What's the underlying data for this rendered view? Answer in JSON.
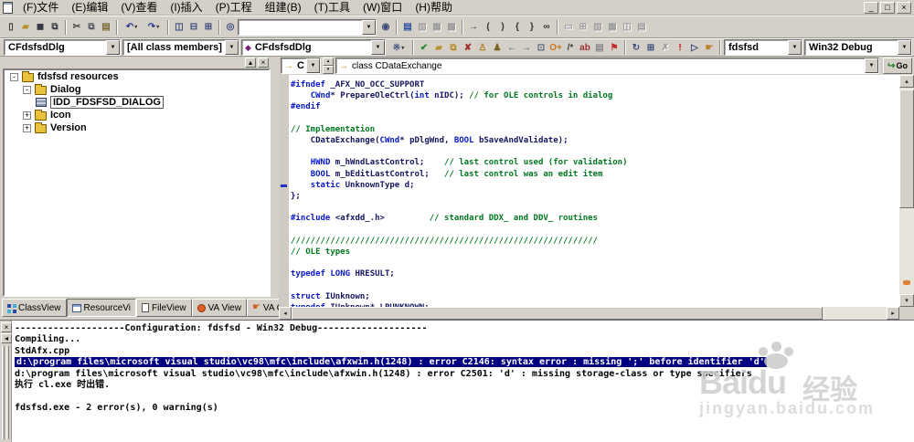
{
  "menu": {
    "items": [
      "(F)文件",
      "(E)编辑",
      "(V)查看",
      "(I)插入",
      "(P)工程",
      "组建(B)",
      "(T)工具",
      "(W)窗口",
      "(H)帮助"
    ]
  },
  "window_buttons": [
    {
      "name": "minimize-button",
      "glyph": "_"
    },
    {
      "name": "restore-button",
      "glyph": "□"
    },
    {
      "name": "close-button",
      "glyph": "×"
    }
  ],
  "toolbar1": {
    "cells": [
      {
        "i": "new-file-icon",
        "g": "▯",
        "c": "#35352a"
      },
      {
        "i": "open-folder-icon",
        "g": "▰",
        "c": "#b8912a"
      },
      {
        "i": "save-icon",
        "g": "◼",
        "c": "#3a3a46"
      },
      {
        "i": "save-all-icon",
        "g": "⧉",
        "c": "#3a3a46"
      },
      {
        "sep": true
      },
      {
        "i": "cut-icon",
        "g": "✂",
        "c": "#444444"
      },
      {
        "i": "copy-icon",
        "g": "⧉",
        "c": "#555566"
      },
      {
        "i": "paste-icon",
        "g": "▤",
        "c": "#7a6a3a"
      },
      {
        "sep": true
      },
      {
        "i": "undo-icon",
        "g": "↶",
        "c": "#2a3a9a",
        "caret": true
      },
      {
        "i": "redo-icon",
        "g": "↷",
        "c": "#2a3a9a",
        "caret": true
      },
      {
        "sep": true
      },
      {
        "i": "workspace-pane-icon",
        "g": "◫",
        "c": "#3a4a7a"
      },
      {
        "i": "output-pane-icon",
        "g": "⊟",
        "c": "#3a4a7a"
      },
      {
        "i": "window-list-icon",
        "g": "⊞",
        "c": "#3a4a7a"
      },
      {
        "sep": true
      },
      {
        "i": "find-in-files-icon",
        "g": "◎",
        "c": "#3a4a7a"
      },
      {
        "combo": "",
        "name": "find-combo",
        "w": 152
      },
      {
        "i": "search-icon",
        "g": "◉",
        "c": "#3a4a7a"
      },
      {
        "sep": true
      },
      {
        "i": "open-header-icon",
        "g": "▤",
        "c": "#2a50a0"
      },
      {
        "i": "edit-code-icon",
        "g": "▥",
        "c": "#999999",
        "d": true
      },
      {
        "i": "list-members-icon",
        "g": "▦",
        "c": "#999999",
        "d": true
      },
      {
        "i": "param-info-icon",
        "g": "▩",
        "c": "#999999",
        "d": true
      },
      {
        "sep": true
      },
      {
        "i": "goto-definition-icon",
        "g": "→",
        "c": "#333333"
      },
      {
        "i": "paren-match-open-icon",
        "g": "(",
        "c": "#333333"
      },
      {
        "i": "paren-match-close-icon",
        "g": ")",
        "c": "#333333"
      },
      {
        "i": "brace-match-open-icon",
        "g": "{",
        "c": "#333333"
      },
      {
        "i": "brace-match-close-icon",
        "g": "}",
        "c": "#333333"
      },
      {
        "i": "reading-glasses-icon",
        "g": "∞",
        "c": "#333333"
      },
      {
        "sep": true
      },
      {
        "i": "test-dialog-icon",
        "g": "▭",
        "c": "#999999",
        "d": true
      },
      {
        "i": "layout-grid-icon",
        "g": "⊞",
        "c": "#999999",
        "d": true
      },
      {
        "i": "align-left-icon",
        "g": "▥",
        "c": "#999999",
        "d": true
      },
      {
        "i": "align-top-icon",
        "g": "▦",
        "c": "#999999",
        "d": true
      },
      {
        "i": "center-horz-icon",
        "g": "◫",
        "c": "#999999",
        "d": true
      },
      {
        "i": "center-vert-icon",
        "g": "▤",
        "c": "#999999",
        "d": true
      }
    ]
  },
  "toolbar2": {
    "cells": [
      {
        "combo": "CFdsfsdDlg",
        "name": "class-combo",
        "w": 128
      },
      {
        "combo": "[All class members]",
        "name": "members-combo",
        "w": 128
      },
      {
        "combo": "CFdsfsdDlg",
        "name": "function-combo",
        "w": 158,
        "diamond": true
      },
      {
        "i": "wizard-actions-icon",
        "g": "※",
        "c": "#405080",
        "caret": true
      },
      {
        "sep": true
      },
      {
        "i": "va-check-file-icon",
        "g": "✔",
        "c": "#2a8a2a"
      },
      {
        "i": "va-open-file-icon",
        "g": "▰",
        "c": "#b8912a"
      },
      {
        "i": "va-rename-icon",
        "g": "⧉",
        "c": "#b8912a"
      },
      {
        "i": "va-find-symbol-icon",
        "g": "✘",
        "c": "#a03030"
      },
      {
        "i": "va-key-gold-icon",
        "g": "♙",
        "c": "#b08020"
      },
      {
        "i": "va-key-brown-icon",
        "g": "♟",
        "c": "#806020"
      },
      {
        "i": "va-back-icon",
        "g": "←",
        "c": "#555555"
      },
      {
        "i": "va-forward-icon",
        "g": "→",
        "c": "#555555"
      },
      {
        "i": "va-paste-icon",
        "g": "⊡",
        "c": "#55617a"
      },
      {
        "i": "va-insert-o-icon",
        "g": "O+",
        "c": "#c87820"
      },
      {
        "i": "va-comment-icon",
        "g": "/*",
        "c": "#444444"
      },
      {
        "i": "va-spell-icon",
        "g": "ab",
        "c": "#a03030"
      },
      {
        "i": "va-note-icon",
        "g": "▤",
        "c": "#888888"
      },
      {
        "i": "va-flag-icon",
        "g": "⚑",
        "c": "#c03030"
      },
      {
        "sep": true
      },
      {
        "i": "compile-icon",
        "g": "↻",
        "c": "#3a4a7a"
      },
      {
        "i": "build-icon",
        "g": "⊞",
        "c": "#3a4a7a"
      },
      {
        "i": "stop-build-icon",
        "g": "✗",
        "c": "#999999",
        "d": true
      },
      {
        "i": "execute-icon",
        "g": "!",
        "c": "#cc1010"
      },
      {
        "i": "debug-go-icon",
        "g": "▷",
        "c": "#3a4a7a"
      },
      {
        "i": "breakpoint-hand-icon",
        "g": "☛",
        "c": "#c08030"
      },
      {
        "sep": true
      },
      {
        "combo": "fdsfsd",
        "name": "project-combo",
        "w": 86
      },
      {
        "combo": "Win32 Debug",
        "name": "config-combo",
        "grow": true
      }
    ]
  },
  "workspace": {
    "pane_buttons": [
      {
        "name": "pane-minimize-button",
        "glyph": "▴"
      },
      {
        "name": "pane-close-button",
        "glyph": "×"
      }
    ],
    "tree": [
      {
        "label": "fdsfsd resources",
        "level": 0,
        "toggle": "-",
        "icon": "folder",
        "selected": false
      },
      {
        "label": "Dialog",
        "level": 1,
        "toggle": "-",
        "icon": "folder",
        "selected": false
      },
      {
        "label": "IDD_FDSFSD_DIALOG",
        "level": 2,
        "toggle": "",
        "icon": "resource",
        "selected": true
      },
      {
        "label": "Icon",
        "level": 1,
        "toggle": "+",
        "icon": "folder",
        "selected": false
      },
      {
        "label": "Version",
        "level": 1,
        "toggle": "+",
        "icon": "folder",
        "selected": false
      }
    ],
    "tabs": [
      {
        "label": "ClassView",
        "icon": "classview-icon",
        "active": false
      },
      {
        "label": "ResourceVi",
        "icon": "resourceview-icon",
        "active": true
      },
      {
        "label": "FileView",
        "icon": "fileview-icon",
        "active": false
      },
      {
        "label": "VA View",
        "icon": "vaview-icon",
        "active": false
      },
      {
        "label": "VA Outlin",
        "icon": "vaoutline-icon",
        "active": false
      }
    ]
  },
  "editor": {
    "nav_context": "C",
    "nav_symbol": "class CDataExchange",
    "go_label": "Go",
    "code_lines": [
      {
        "segs": [
          [
            "k",
            "#ifndef"
          ],
          [
            "i",
            " _AFX_NO_OCC_SUPPORT"
          ]
        ]
      },
      {
        "segs": [
          [
            "i",
            "    "
          ],
          [
            "k",
            "CWnd"
          ],
          [
            "i",
            "* PrepareOleCtrl("
          ],
          [
            "k",
            "int"
          ],
          [
            "i",
            " nIDC); "
          ],
          [
            "c",
            "// for OLE controls in dialog"
          ]
        ]
      },
      {
        "segs": [
          [
            "k",
            "#endif"
          ]
        ]
      },
      {
        "segs": []
      },
      {
        "segs": [
          [
            "c",
            "// Implementation"
          ]
        ]
      },
      {
        "segs": [
          [
            "i",
            "    CDataExchange("
          ],
          [
            "k",
            "CWnd"
          ],
          [
            "i",
            "* pDlgWnd, "
          ],
          [
            "k",
            "BOOL"
          ],
          [
            "i",
            " bSaveAndValidate);"
          ]
        ]
      },
      {
        "segs": []
      },
      {
        "segs": [
          [
            "i",
            "    "
          ],
          [
            "k",
            "HWND"
          ],
          [
            "i",
            " m_hWndLastControl;    "
          ],
          [
            "c",
            "// last control used (for validation)"
          ]
        ]
      },
      {
        "segs": [
          [
            "i",
            "    "
          ],
          [
            "k",
            "BOOL"
          ],
          [
            "i",
            " m_bEditLastControl;   "
          ],
          [
            "c",
            "// last control was an edit item"
          ]
        ]
      },
      {
        "segs": [
          [
            "i",
            "    "
          ],
          [
            "k",
            "static"
          ],
          [
            "i",
            " UnknownType d;"
          ]
        ],
        "marker": true
      },
      {
        "segs": [
          [
            "i",
            "};"
          ]
        ]
      },
      {
        "segs": []
      },
      {
        "segs": [
          [
            "k",
            "#include"
          ],
          [
            "i",
            " <afxdd_.h>         "
          ],
          [
            "c",
            "// standard DDX_ and DDV_ routines"
          ]
        ]
      },
      {
        "segs": []
      },
      {
        "segs": [
          [
            "c",
            "//////////////////////////////////////////////////////////////"
          ]
        ]
      },
      {
        "segs": [
          [
            "c",
            "// OLE types"
          ]
        ]
      },
      {
        "segs": []
      },
      {
        "segs": [
          [
            "k",
            "typedef"
          ],
          [
            "i",
            " "
          ],
          [
            "k",
            "LONG"
          ],
          [
            "i",
            " HRESULT;"
          ]
        ]
      },
      {
        "segs": []
      },
      {
        "segs": [
          [
            "k",
            "struct"
          ],
          [
            "i",
            " IUnknown;"
          ]
        ]
      },
      {
        "segs": [
          [
            "k",
            "typedef"
          ],
          [
            "i",
            " IUnknown* LPUNKNOWN;"
          ]
        ]
      }
    ]
  },
  "output": {
    "lines": [
      {
        "text": "--------------------Configuration: fdsfsd - Win32 Debug--------------------",
        "highlight": false
      },
      {
        "text": "Compiling...",
        "highlight": false
      },
      {
        "text": "StdAfx.cpp",
        "highlight": false
      },
      {
        "text": "d:\\program files\\microsoft visual studio\\vc98\\mfc\\include\\afxwin.h(1248) : error C2146: syntax error : missing ';' before identifier 'd'",
        "highlight": true
      },
      {
        "text": "d:\\program files\\microsoft visual studio\\vc98\\mfc\\include\\afxwin.h(1248) : error C2501: 'd' : missing storage-class or type specifiers",
        "highlight": false
      },
      {
        "text": "执行 cl.exe 时出错.",
        "highlight": false
      },
      {
        "text": "",
        "highlight": false
      },
      {
        "text": "fdsfsd.exe - 2 error(s), 0 warning(s)",
        "highlight": false
      }
    ]
  },
  "watermark": {
    "brand": "Baidu",
    "suffix": "经验",
    "url": "jingyan.baidu.com"
  },
  "colors": {
    "highlight_bg": "#000080",
    "keyword": "#0818c8",
    "comment": "#007820",
    "chrome": "#d4d0c8"
  }
}
